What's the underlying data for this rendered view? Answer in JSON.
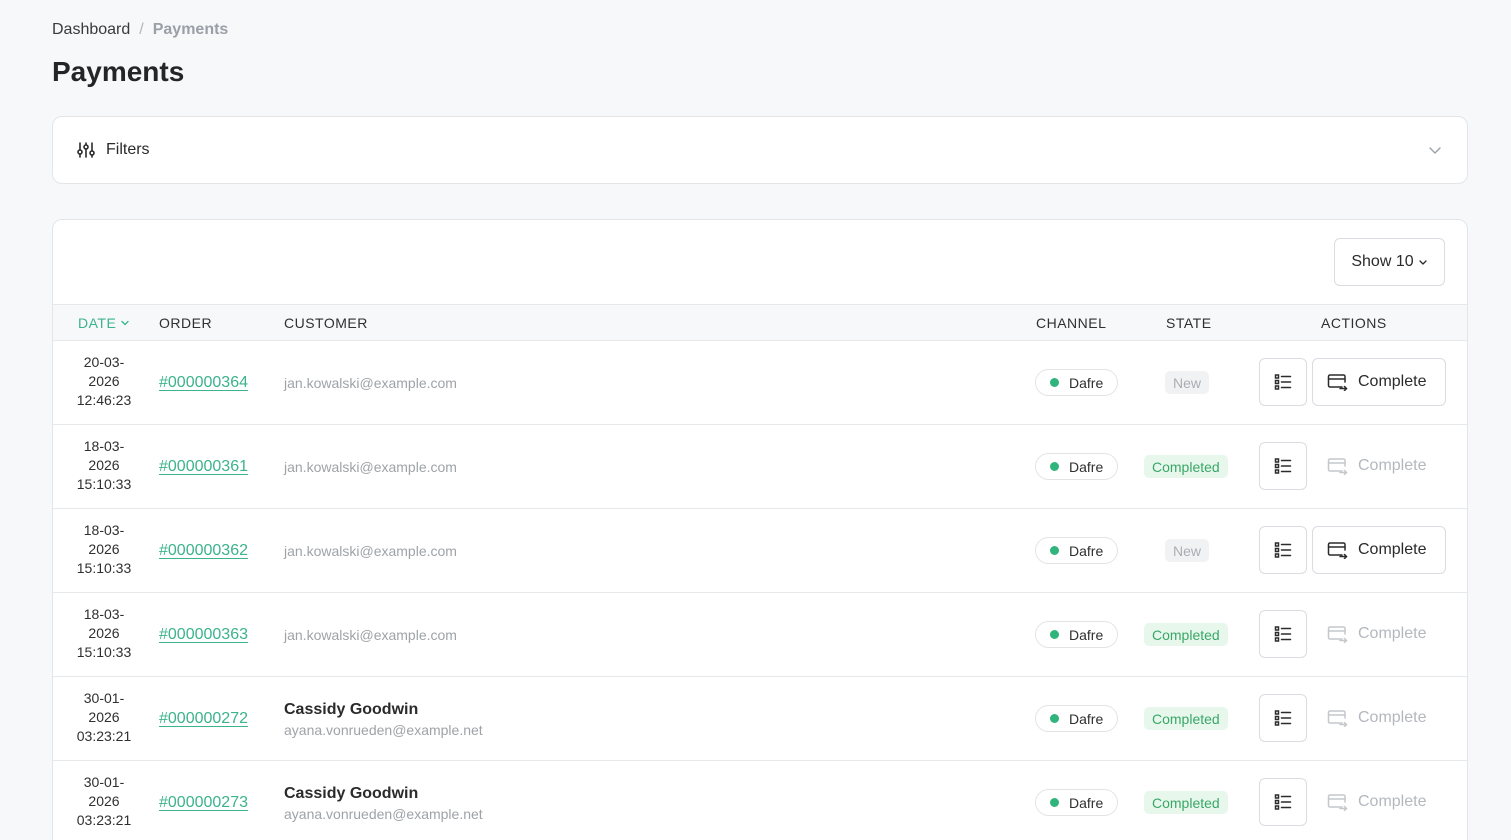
{
  "breadcrumb": {
    "home": "Dashboard",
    "separator": "/",
    "current": "Payments"
  },
  "page_title": "Payments",
  "filters": {
    "label": "Filters",
    "icon": "sliders-icon",
    "toggle_icon": "chevron-down-icon"
  },
  "table": {
    "page_size_label": "Show 10",
    "columns": {
      "date": "DATE",
      "order": "ORDER",
      "customer": "CUSTOMER",
      "channel": "CHANNEL",
      "state": "STATE",
      "actions": "ACTIONS"
    },
    "sorted_column": "date",
    "rows": [
      {
        "date": [
          "20-03-",
          "2026",
          "12:46:23"
        ],
        "order": "#000000364",
        "customer_name": "",
        "customer_email": "jan.kowalski@example.com",
        "channel": "Dafre",
        "state": "New",
        "action_label": "Complete",
        "action_enabled": true
      },
      {
        "date": [
          "18-03-",
          "2026",
          "15:10:33"
        ],
        "order": "#000000361",
        "customer_name": "",
        "customer_email": "jan.kowalski@example.com",
        "channel": "Dafre",
        "state": "Completed",
        "action_label": "Complete",
        "action_enabled": false
      },
      {
        "date": [
          "18-03-",
          "2026",
          "15:10:33"
        ],
        "order": "#000000362",
        "customer_name": "",
        "customer_email": "jan.kowalski@example.com",
        "channel": "Dafre",
        "state": "New",
        "action_label": "Complete",
        "action_enabled": true
      },
      {
        "date": [
          "18-03-",
          "2026",
          "15:10:33"
        ],
        "order": "#000000363",
        "customer_name": "",
        "customer_email": "jan.kowalski@example.com",
        "channel": "Dafre",
        "state": "Completed",
        "action_label": "Complete",
        "action_enabled": false
      },
      {
        "date": [
          "30-01-",
          "2026",
          "03:23:21"
        ],
        "order": "#000000272",
        "customer_name": "Cassidy Goodwin",
        "customer_email": "ayana.vonrueden@example.net",
        "channel": "Dafre",
        "state": "Completed",
        "action_label": "Complete",
        "action_enabled": false
      },
      {
        "date": [
          "30-01-",
          "2026",
          "03:23:21"
        ],
        "order": "#000000273",
        "customer_name": "Cassidy Goodwin",
        "customer_email": "ayana.vonrueden@example.net",
        "channel": "Dafre",
        "state": "Completed",
        "action_label": "Complete",
        "action_enabled": false
      }
    ]
  },
  "colors": {
    "accent": "#3bb38c",
    "channel_dot": "#2fb47c",
    "completed_text": "#3aa768",
    "completed_bg": "#e7f7ec",
    "new_text": "#a9aeb3",
    "new_bg": "#f1f2f4"
  }
}
